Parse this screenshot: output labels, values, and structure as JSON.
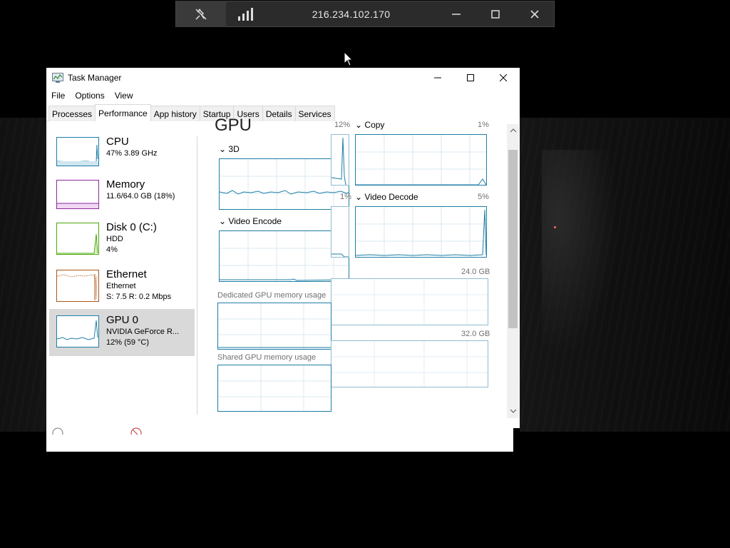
{
  "remote_toolbar": {
    "ip_address": "216.234.102.170",
    "icons": [
      "unpin-icon",
      "signal-bars-icon",
      "minimize-icon",
      "maximize-icon",
      "close-icon"
    ]
  },
  "task_manager": {
    "title": "Task Manager",
    "menu": [
      "File",
      "Options",
      "View"
    ],
    "tabs": [
      "Processes",
      "Performance",
      "App history",
      "Startup",
      "Users",
      "Details",
      "Services"
    ],
    "active_tab": "Performance",
    "resources": [
      {
        "name": "CPU",
        "line1": "47%  3.89 GHz",
        "line2": "",
        "color": "#1d7ea6"
      },
      {
        "name": "Memory",
        "line1": "11.6/64.0 GB (18%)",
        "line2": "",
        "color": "#8b2a9b"
      },
      {
        "name": "Disk 0 (C:)",
        "line1": "HDD",
        "line2": "4%",
        "color": "#4ca80a"
      },
      {
        "name": "Ethernet",
        "line1": "Ethernet",
        "line2": "S: 7.5  R: 0.2 Mbps",
        "color": "#a8571b"
      },
      {
        "name": "GPU 0",
        "line1": "NVIDIA GeForce R...",
        "line2": "12%  (59 °C)",
        "color": "#1d7ea6",
        "selected": true
      }
    ],
    "gpu": {
      "heading": "GPU",
      "engines": [
        {
          "label": "3D",
          "percent": "12%"
        },
        {
          "label": "Copy",
          "percent": "1%"
        },
        {
          "label": "Video Encode",
          "percent": "1%"
        },
        {
          "label": "Video Decode",
          "percent": "5%"
        }
      ],
      "dedicated_label": "Dedicated GPU memory usage",
      "dedicated_max": "24.0 GB",
      "shared_label": "Shared GPU memory usage",
      "shared_max": "32.0 GB"
    }
  }
}
